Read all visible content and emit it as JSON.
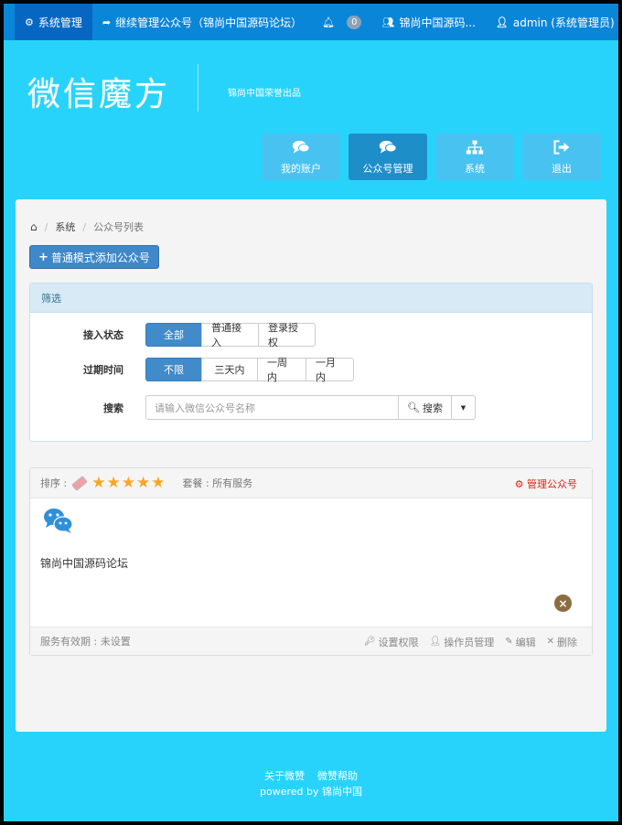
{
  "topnav": {
    "system_manage": "系统管理",
    "continue_manage": "继续管理公众号（锦尚中国源码论坛）",
    "notifications_count": "0",
    "account_short": "锦尚中国源码...",
    "user": "admin (系统管理员)"
  },
  "header": {
    "logo": "微信魔方",
    "tagline": "锦尚中国荣誉出品"
  },
  "tiles": [
    {
      "label": "我的账户",
      "icon": "comments-icon"
    },
    {
      "label": "公众号管理",
      "icon": "comments-icon"
    },
    {
      "label": "系统",
      "icon": "sitemap-icon"
    },
    {
      "label": "退出",
      "icon": "sign-out-icon"
    }
  ],
  "breadcrumb": {
    "home": "home-icon",
    "level1": "系统",
    "level2": "公众号列表"
  },
  "add_button": "普通模式添加公众号",
  "filter": {
    "title": "筛选",
    "access_label": "接入状态",
    "access_options": [
      "全部",
      "普通接入",
      "登录授权"
    ],
    "expire_label": "过期时间",
    "expire_options": [
      "不限",
      "三天内",
      "一周内",
      "一月内"
    ],
    "search_label": "搜索",
    "search_placeholder": "请输入微信公众号名称",
    "search_button": "搜索"
  },
  "account": {
    "sort_label": "排序 :",
    "plan": "套餐 : 所有服务",
    "manage": "管理公众号",
    "name": "锦尚中国源码论坛",
    "validity": "服务有效期 : 未设置",
    "actions": [
      "设置权限",
      "操作员管理",
      "编辑",
      "删除"
    ],
    "rating": 5
  },
  "footer": {
    "about": "关于微赞",
    "help": "微赞帮助",
    "powered": "powered by 锦尚中国"
  },
  "colors": {
    "page_bg": "#27d3fb",
    "nav_bg": "#0a86d9",
    "primary": "#428bca",
    "danger": "#d9230f"
  }
}
